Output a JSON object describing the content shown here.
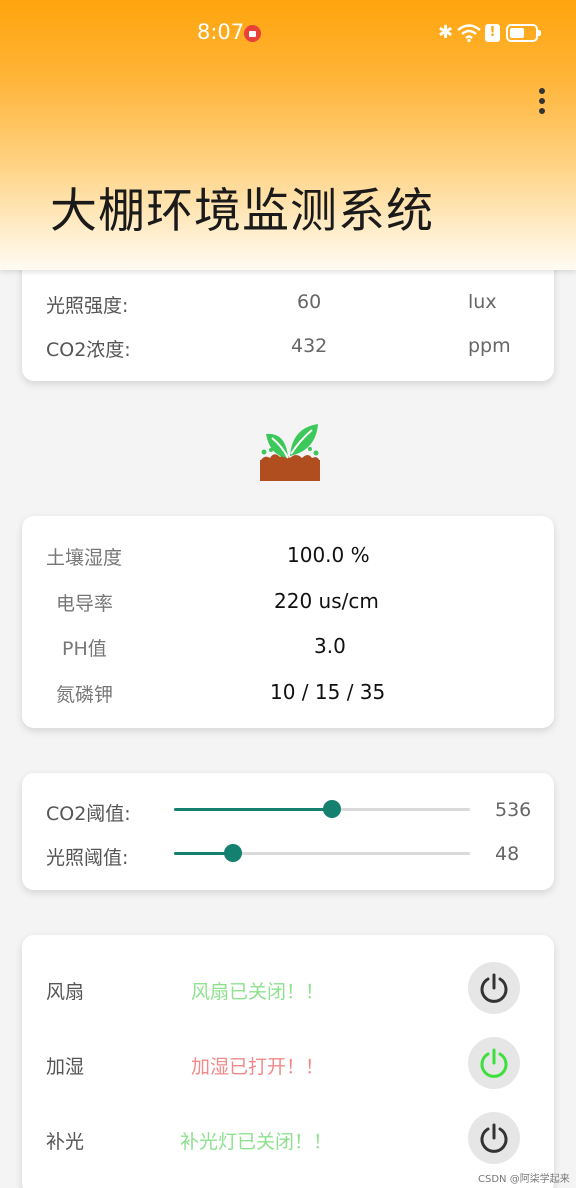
{
  "status_bar": {
    "time": "8:07",
    "bluetooth": "bluetooth-icon",
    "wifi": "wifi-icon",
    "battery": "battery-icon"
  },
  "app": {
    "title": "大棚环境监测系统",
    "menu_icon": "more-vert-icon"
  },
  "env_card": {
    "light_label": "光照强度:",
    "light_value": "60",
    "light_unit": "lux",
    "co2_label": "CO2浓度:",
    "co2_value": "432",
    "co2_unit": "ppm"
  },
  "soil_card": {
    "humidity_label": "土壤湿度",
    "humidity_value": "100.0  %",
    "conductivity_label": "电导率",
    "conductivity_value": "220  us/cm",
    "ph_label": "PH值",
    "ph_value": "3.0",
    "npk_label": "氮磷钾",
    "npk_value": "10 / 15 / 35"
  },
  "threshold_card": {
    "co2_label": "CO2阈值:",
    "co2_value": "536",
    "co2_fraction": 0.535,
    "light_label": "光照阈值:",
    "light_value": "48",
    "light_fraction": 0.2
  },
  "control_card": {
    "fan_label": "风扇",
    "fan_status": "风扇已关闭！！",
    "fan_on": false,
    "humidify_label": "加湿",
    "humidify_status": "加湿已打开！！",
    "humidify_on": true,
    "light_label": "补光",
    "light_status": "补光灯已关闭！！",
    "light_on": false
  },
  "colors": {
    "accent": "#148070",
    "header_top": "#ffa40c",
    "power_on": "#3be03b",
    "power_off": "#333333",
    "status_off_text": "#8fe08f",
    "status_on_text": "#f08a8a"
  },
  "watermark": "CSDN @阿柒学起来"
}
